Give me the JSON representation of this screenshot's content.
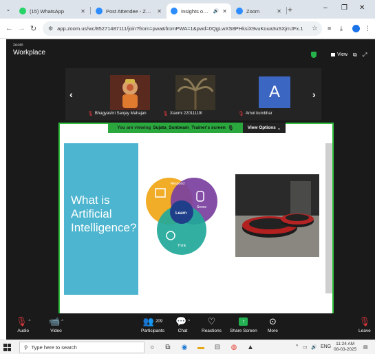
{
  "browser": {
    "tabs": [
      {
        "title": "(15) WhatsApp",
        "favicon_color": "#25d366"
      },
      {
        "title": "Post Attendee - Zoom",
        "favicon_color": "#2d8cff"
      },
      {
        "title": "Insights on AI",
        "favicon_color": "#2d8cff"
      },
      {
        "title": "Zoom",
        "favicon_color": "#2d8cff"
      }
    ],
    "new_tab_glyph": "+",
    "window_controls": {
      "minimize": "–",
      "restore": "❐",
      "close": "✕"
    },
    "url": "app.zoom.us/wc/85271487111/join?from=pwa&fromPWA=1&pwd=0QgLwXS8PHksiX9vuKoua3uSXjmJFx.1"
  },
  "zoom": {
    "brand_small": "zoom",
    "brand": "Workplace",
    "view_label": "View",
    "participants_strip": [
      {
        "name": "Bhagyashri Sanjay Mahajan",
        "muted": true
      },
      {
        "name": "Xiaomi 22011119I",
        "muted": true
      },
      {
        "name": "Amol kumbhar",
        "muted": true,
        "avatar_letter": "A"
      }
    ],
    "share_banner": {
      "prefix": "You are viewing",
      "name": "Sujata_Sunbeam_Trainer's screen",
      "view_options": "View Options"
    },
    "slide": {
      "title": "What is Artificial Intelligence?",
      "venn": {
        "top": "Respond",
        "right": "Sense",
        "center": "Learn",
        "bottom": "Think"
      }
    },
    "toolbar": {
      "audio": "Audio",
      "video": "Video",
      "participants": "Participants",
      "participants_count": "209",
      "chat": "Chat",
      "reactions": "Reactions",
      "share_screen": "Share Screen",
      "more": "More",
      "leave": "Leave"
    }
  },
  "taskbar": {
    "search_placeholder": "Type here to search",
    "lang": "ENG",
    "time": "11:24 AM",
    "date": "08-03-2025"
  }
}
